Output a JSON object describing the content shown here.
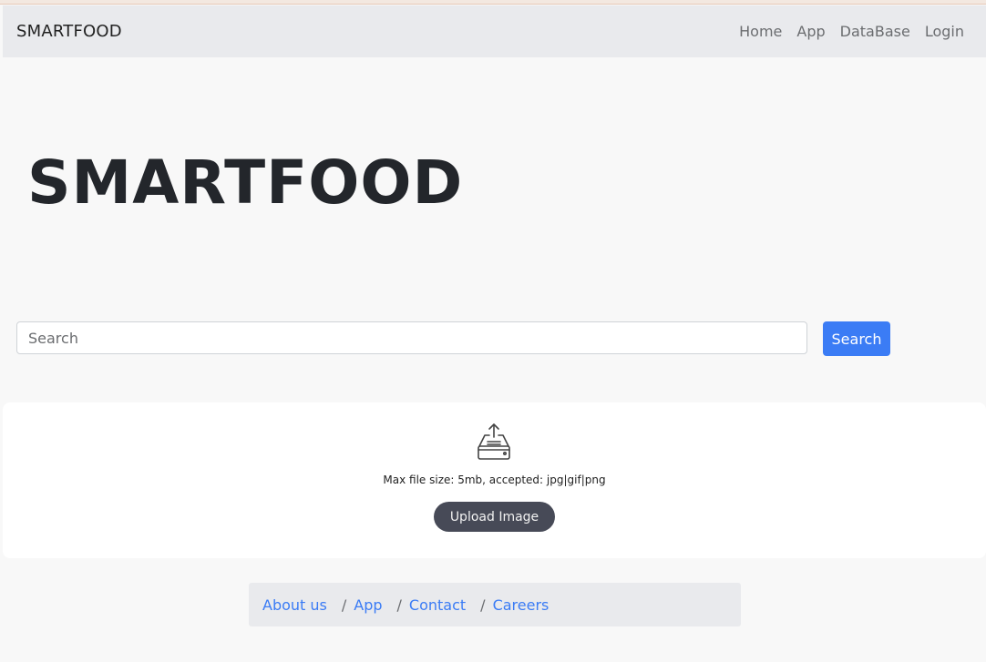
{
  "navbar": {
    "brand": "SMARTFOOD",
    "links": [
      "Home",
      "App",
      "DataBase",
      "Login"
    ]
  },
  "hero": {
    "title": "SMARTFOOD"
  },
  "search": {
    "placeholder": "Search",
    "button_label": "Search"
  },
  "upload": {
    "icon": "upload-tray-icon",
    "hint": "Max file size: 5mb, accepted: jpg|gif|png",
    "button_label": "Upload Image"
  },
  "footer": {
    "links": [
      "About us",
      "App",
      "Contact",
      "Careers"
    ],
    "separator": "/"
  },
  "colors": {
    "primary": "#3b7cf5",
    "upload_button": "#474a57",
    "navbar_bg": "#e9eaed",
    "page_bg": "#f8f8f8"
  }
}
